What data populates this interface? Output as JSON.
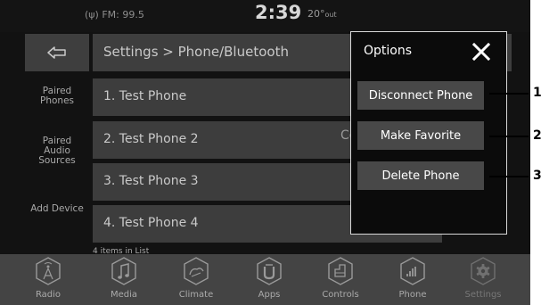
{
  "status": {
    "radio": "FM: 99.5",
    "time": "2:39",
    "temperature": "20°",
    "temperature_suffix": "out"
  },
  "header": {
    "back_icon": "back-arrow-icon",
    "breadcrumb": "Settings > Phone/Bluetooth"
  },
  "sidebar": {
    "items": [
      {
        "line1": "Paired",
        "line2": "Phones"
      },
      {
        "line1": "Paired",
        "line2": "Audio",
        "line3": "Sources"
      },
      {
        "line1": "Add Device"
      }
    ]
  },
  "list": {
    "items": [
      {
        "label": "1. Test Phone"
      },
      {
        "label": "2. Test Phone 2"
      },
      {
        "label": "3. Test Phone 3"
      },
      {
        "label": "4. Test Phone 4"
      }
    ],
    "partial_text": "Co",
    "count_text": "4 items in List"
  },
  "options": {
    "title": "Options",
    "close_icon": "close-icon",
    "buttons": [
      {
        "label": "Disconnect Phone"
      },
      {
        "label": "Make Favorite"
      },
      {
        "label": "Delete Phone"
      }
    ]
  },
  "callouts": [
    "1",
    "2",
    "3"
  ],
  "nav": {
    "items": [
      {
        "label": "Radio",
        "icon": "radio-icon"
      },
      {
        "label": "Media",
        "icon": "media-icon"
      },
      {
        "label": "Climate",
        "icon": "climate-icon"
      },
      {
        "label": "Apps",
        "icon": "apps-icon"
      },
      {
        "label": "Controls",
        "icon": "controls-icon"
      },
      {
        "label": "Phone",
        "icon": "phone-icon"
      },
      {
        "label": "Settings",
        "icon": "settings-icon"
      }
    ]
  }
}
